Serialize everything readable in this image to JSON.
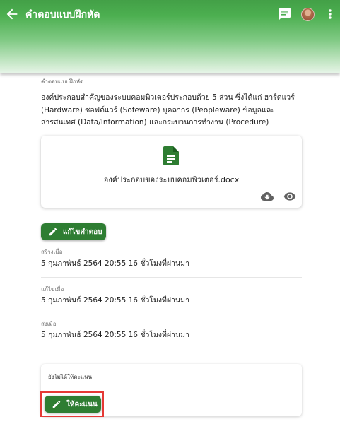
{
  "appbar": {
    "title": "คำตอบแบบฝึกหัด",
    "icons": [
      "arrow-back-icon",
      "chat-icon",
      "avatar",
      "more-vert-icon"
    ],
    "color": "#4caf50"
  },
  "answer": {
    "caption": "คำตอบแบบฝึกหัด",
    "text": "องค์ประกอบสำคัญของระบบคอมพิวเตอร์ประกอบด้วย 5 ส่วน ซึ่งได้แก่ ฮาร์ดแวร์ (Hardware) ซอฟต์แวร์ (Sofeware) บุคลากร (Peopleware) ข้อมูลและสารสนเทศ (Data/Information) และกระบวนการทำงาน (Procedure)"
  },
  "attachment": {
    "filename": "องค์ประกอบของระบบคอมพิวเตอร์.docx",
    "icon": "document-icon",
    "actions": [
      "download-icon",
      "view-icon"
    ]
  },
  "edit_button": {
    "label": "แก้ไขคำตอบ",
    "icon": "pencil-icon"
  },
  "meta": {
    "created_label": "สร้างเมื่อ",
    "created_value": "5 กุมภาพันธ์ 2564 20:55 16 ชั่วโมงที่ผ่านมา",
    "edited_label": "แก้ไขเมื่อ",
    "edited_value": "5 กุมภาพันธ์ 2564 20:55 16 ชั่วโมงที่ผ่านมา",
    "sent_label": "ส่งเมื่อ",
    "sent_value": "5 กุมภาพันธ์ 2564 20:55 16 ชั่วโมงที่ผ่านมา"
  },
  "grading": {
    "status": "ยังไม่ได้ให้คะแนน",
    "button_label": "ให้คะแนน",
    "button_icon": "pencil-icon",
    "highlight_color": "#e53935"
  },
  "colors": {
    "primary_button": "#2e7d32",
    "doc_icon": "#2e7d32"
  }
}
